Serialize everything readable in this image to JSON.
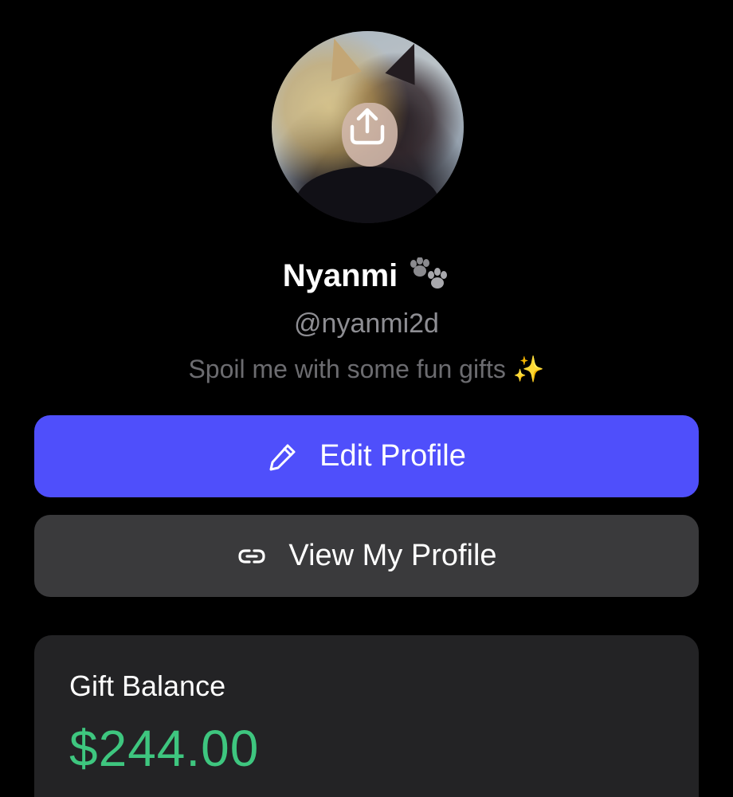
{
  "profile": {
    "display_name": "Nyanmi",
    "name_emoji": "paw-prints-icon",
    "handle": "@nyanmi2d",
    "bio_text": "Spoil me with some fun gifts",
    "bio_emoji": "✨"
  },
  "avatar": {
    "overlay_icon": "upload-icon"
  },
  "actions": {
    "edit_profile_label": "Edit Profile",
    "edit_profile_icon": "pencil-icon",
    "view_profile_label": "View My Profile",
    "view_profile_icon": "link-icon"
  },
  "gift_balance": {
    "title": "Gift Balance",
    "amount": "$244.00"
  },
  "colors": {
    "background": "#000000",
    "primary_button": "#4f4ffb",
    "secondary_button": "#3a3a3c",
    "card": "#232325",
    "balance_green": "#3ec67f",
    "handle_gray": "#8e8e93"
  }
}
